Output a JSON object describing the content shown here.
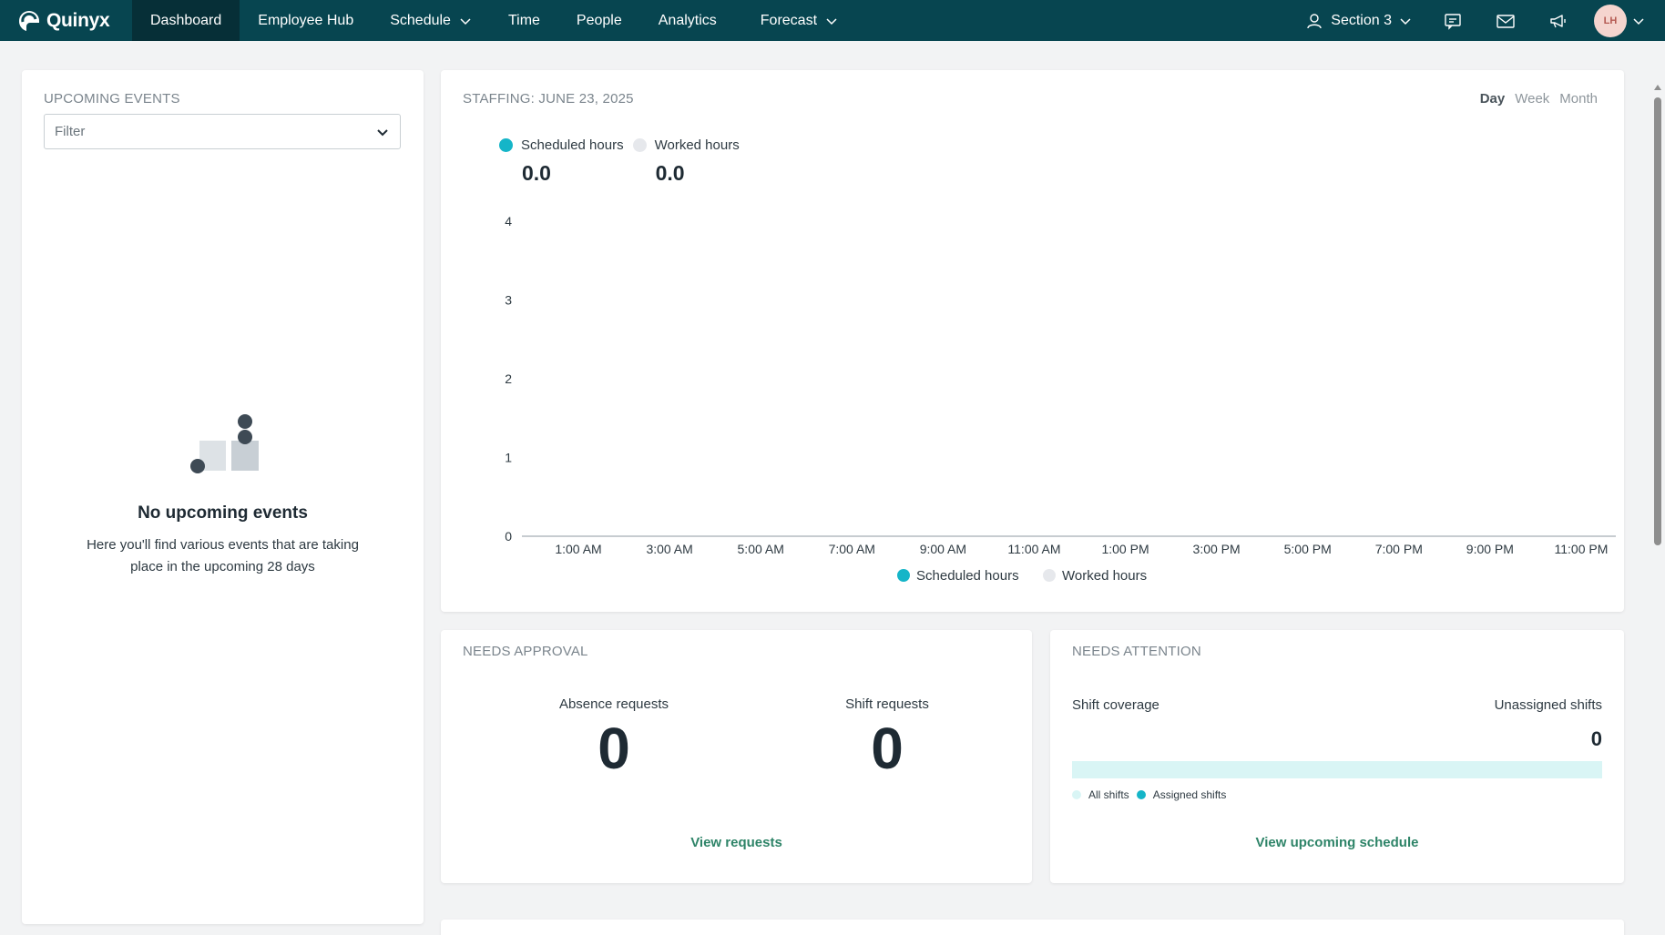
{
  "app": {
    "logo_text": "Quinyx",
    "logo_icon": "quinyx-logo-icon"
  },
  "nav": {
    "items": [
      {
        "label": "Dashboard",
        "active": true,
        "dropdown": false
      },
      {
        "label": "Employee Hub",
        "active": false,
        "dropdown": false
      },
      {
        "label": "Schedule",
        "active": false,
        "dropdown": true
      },
      {
        "label": "Time",
        "active": false,
        "dropdown": false
      },
      {
        "label": "People",
        "active": false,
        "dropdown": false
      },
      {
        "label": "Analytics",
        "active": false,
        "dropdown": false
      },
      {
        "label": "Forecast",
        "active": false,
        "dropdown": true
      }
    ],
    "section_label": "Section 3",
    "icons": [
      "user-icon",
      "chat-icon",
      "mail-icon",
      "megaphone-icon"
    ],
    "avatar_initials": "LH"
  },
  "events": {
    "title": "UPCOMING EVENTS",
    "filter_placeholder": "Filter",
    "empty_title": "No upcoming events",
    "empty_desc": "Here you'll find various events that are taking place in the upcoming 28 days"
  },
  "staffing": {
    "title": "STAFFING: JUNE 23, 2025",
    "range_tabs": [
      {
        "label": "Day",
        "active": true
      },
      {
        "label": "Week",
        "active": false
      },
      {
        "label": "Month",
        "active": false
      }
    ],
    "scheduled_label": "Scheduled hours",
    "scheduled_value": "0.0",
    "worked_label": "Worked hours",
    "worked_value": "0.0"
  },
  "chart_data": {
    "type": "line",
    "title": "",
    "xlabel": "",
    "ylabel": "",
    "ylim": [
      0,
      4
    ],
    "y_ticks": [
      "0",
      "1",
      "2",
      "3",
      "4"
    ],
    "x_tick_labels": [
      "1:00 AM",
      "3:00 AM",
      "5:00 AM",
      "7:00 AM",
      "9:00 AM",
      "11:00 AM",
      "1:00 PM",
      "3:00 PM",
      "5:00 PM",
      "7:00 PM",
      "9:00 PM",
      "11:00 PM"
    ],
    "series": [
      {
        "name": "Scheduled hours",
        "color": "#15b5c8",
        "values": []
      },
      {
        "name": "Worked hours",
        "color": "#e6e8ec",
        "values": []
      }
    ],
    "legend_position": "bottom"
  },
  "approval": {
    "title": "NEEDS APPROVAL",
    "absence_label": "Absence requests",
    "absence_value": "0",
    "shift_label": "Shift requests",
    "shift_value": "0",
    "link": "View requests"
  },
  "attention": {
    "title": "NEEDS ATTENTION",
    "coverage_label": "Shift coverage",
    "unassigned_label": "Unassigned shifts",
    "unassigned_value": "0",
    "coverage_assigned_fraction": 0,
    "legend_all": "All shifts",
    "legend_assigned": "Assigned shifts",
    "link": "View upcoming schedule"
  },
  "colors": {
    "nav_bg": "#074550",
    "nav_active": "#062f37",
    "accent": "#15b5c8",
    "link": "#2e8468",
    "all_shifts": "#d9f5f5"
  }
}
